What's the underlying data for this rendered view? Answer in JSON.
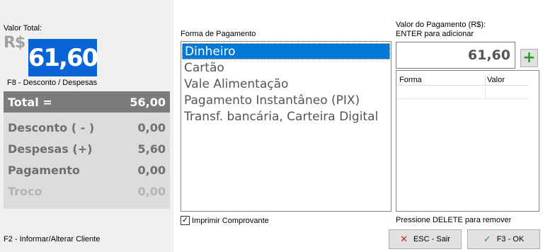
{
  "left": {
    "valor_total_label": "Valor Total:",
    "currency_symbol": "R$",
    "total_value": "61,60",
    "f8_hint": "F8 - Desconto / Despesas",
    "summary": {
      "total_label": "Total =",
      "total_value": "56,00",
      "desconto_label": "Desconto ( - )",
      "desconto_value": "0,00",
      "despesas_label": "Despesas (+)",
      "despesas_value": "5,60",
      "pagamento_label": "Pagamento",
      "pagamento_value": "0,00",
      "troco_label": "Troco",
      "troco_value": "0,00"
    },
    "f2_hint": "F2 - Informar/Alterar Cliente"
  },
  "middle": {
    "forma_label": "Forma de Pagamento",
    "formas": [
      "Dinheiro",
      "Cartão",
      "Vale Alimentação",
      "Pagamento Instantâneo (PIX)",
      "Transf. bancária, Carteira Digital"
    ],
    "selected_index": 0,
    "imprimir_label": "Imprimir Comprovante",
    "imprimir_checked": true
  },
  "right": {
    "valor_pag_label_1": "Valor do Pagamento (R$):",
    "valor_pag_label_2": "ENTER para adicionar",
    "valor_pag_value": "61,60",
    "add_icon": "plus-icon",
    "grid": {
      "col_forma": "Forma",
      "col_valor": "Valor"
    },
    "delete_hint": "Pressione DELETE para remover",
    "esc_label": "ESC - Sair",
    "ok_label": "F3 - OK"
  },
  "colors": {
    "accent_blue": "#0a64d6",
    "selection_blue": "#0078d7",
    "add_green": "#2e9a2e",
    "cancel_red": "#d42020",
    "total_row_bg": "#7c7c7c"
  }
}
